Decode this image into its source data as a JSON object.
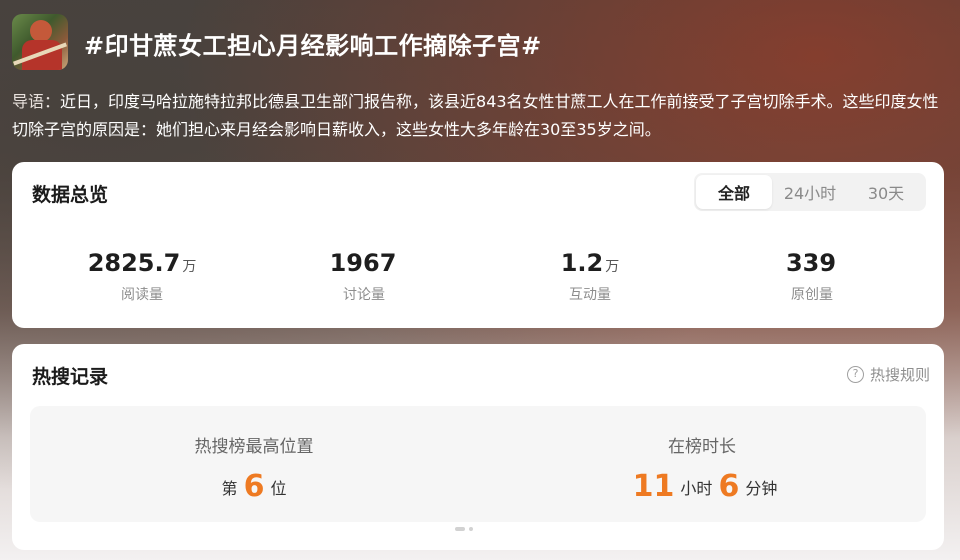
{
  "topic": {
    "title": "#印甘蔗女工担心月经影响工作摘除子宫#",
    "intro_label": "导语：",
    "intro_text": "近日，印度马哈拉施特拉邦比德县卫生部门报告称，该县近843名女性甘蔗工人在工作前接受了子宫切除手术。这些印度女性切除子宫的原因是：她们担心来月经会影响日薪收入，这些女性大多年龄在30至35岁之间。"
  },
  "overview": {
    "title": "数据总览",
    "tabs": [
      "全部",
      "24小时",
      "30天"
    ],
    "active_tab": "全部",
    "stats": [
      {
        "value": "2825.7",
        "unit": "万",
        "label": "阅读量"
      },
      {
        "value": "1967",
        "unit": "",
        "label": "讨论量"
      },
      {
        "value": "1.2",
        "unit": "万",
        "label": "互动量"
      },
      {
        "value": "339",
        "unit": "",
        "label": "原创量"
      }
    ]
  },
  "hot": {
    "title": "热搜记录",
    "rules_label": "热搜规则",
    "rank_label": "热搜榜最高位置",
    "rank_prefix": "第",
    "rank_value": "6",
    "rank_suffix": "位",
    "duration_label": "在榜时长",
    "hours_value": "11",
    "hours_unit": "小时",
    "minutes_value": "6",
    "minutes_unit": "分钟"
  },
  "colors": {
    "accent": "#ee7a22"
  }
}
